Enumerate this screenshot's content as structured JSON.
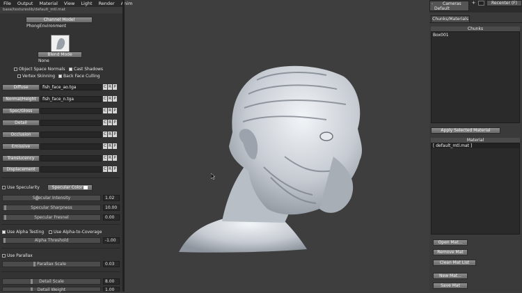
{
  "menu": [
    "File",
    "Output",
    "Material",
    "View",
    "Light",
    "Render",
    "Anim"
  ],
  "path": "base/textureslib/default_mtl.mat",
  "channel_model": {
    "button": "Channel Model",
    "value": "PhongEnvironment"
  },
  "blend_mode": {
    "button": "Blend Mode",
    "value": "None"
  },
  "checkboxes": {
    "object_space_normals": "Object Space Normals",
    "cast_shadows": "Cast Shadows",
    "vertex_skinning": "Vertex Skinning",
    "back_face_culling": "Back Face Culling"
  },
  "channels": [
    {
      "label": "Diffuse",
      "value": "fish_face_ao.tga"
    },
    {
      "label": "Normal/Height",
      "value": "fish_face_n.tga"
    },
    {
      "label": "Spec/Gloss",
      "value": ""
    },
    {
      "label": "Detail",
      "value": ""
    },
    {
      "label": "Occlusion",
      "value": ""
    },
    {
      "label": "Emissive",
      "value": ""
    },
    {
      "label": "Translucency",
      "value": ""
    },
    {
      "label": "Displacement",
      "value": ""
    }
  ],
  "crp": [
    "C",
    "R",
    "P"
  ],
  "specularity": {
    "use": "Use Specularity",
    "color_button": "Specular Color",
    "sliders": [
      {
        "label": "Specular Intensity",
        "value": "1.02"
      },
      {
        "label": "Specular Sharpness",
        "value": "10.00"
      },
      {
        "label": "Specular Fresnel",
        "value": "0.00"
      }
    ]
  },
  "alpha": {
    "use_testing": "Use Alpha Testing",
    "use_coverage": "Use Alpha-to-Coverage",
    "threshold_label": "Alpha Threshold",
    "threshold_value": "-1.00"
  },
  "parallax": {
    "use": "Use Parallax",
    "scale_label": "Parallax Scale",
    "scale_value": "0.03"
  },
  "detail": [
    {
      "label": "Detail Scale",
      "value": "8.00"
    },
    {
      "label": "Detail Weight",
      "value": "1.00"
    }
  ],
  "cameras": {
    "label": "Cameras",
    "value": "Default",
    "recenter": "Recenter (F)"
  },
  "tab": "Chunks/Materials",
  "chunks": {
    "header": "Chunks",
    "items": [
      "Box001"
    ]
  },
  "apply_button": "Apply Selected Material",
  "material": {
    "header": "Material",
    "items": [
      "[ default_mtl.mat ]"
    ]
  },
  "buttons": [
    "Open Mat...",
    "Remove Mat",
    "Clean Mat List",
    "New Mat...",
    "Save Mat"
  ]
}
